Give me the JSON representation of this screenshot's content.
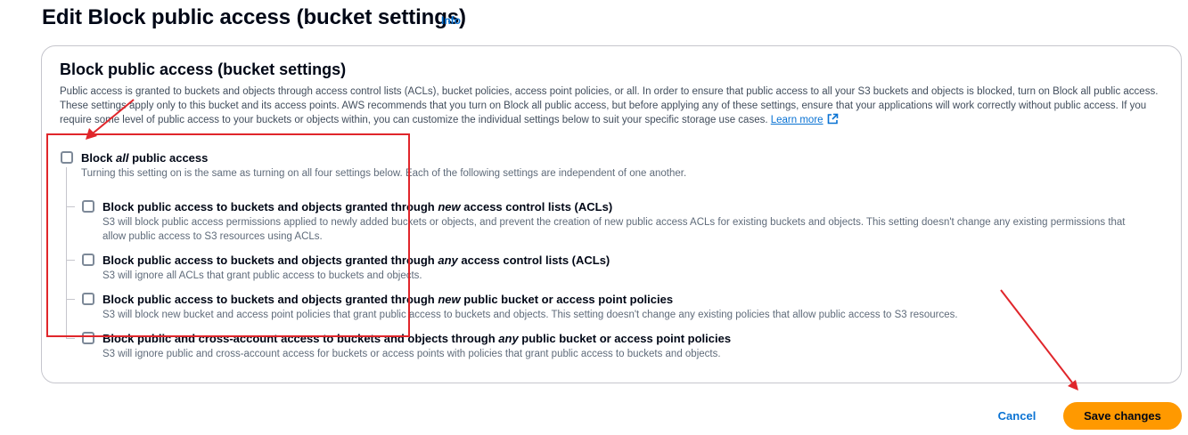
{
  "header": {
    "title": "Edit Block public access (bucket settings)",
    "info_label": "Info"
  },
  "panel": {
    "title": "Block public access (bucket settings)",
    "description": "Public access is granted to buckets and objects through access control lists (ACLs), bucket policies, access point policies, or all. In order to ensure that public access to all your S3 buckets and objects is blocked, turn on Block all public access. These settings apply only to this bucket and its access points. AWS recommends that you turn on Block all public access, but before applying any of these settings, ensure that your applications will work correctly without public access. If you require some level of public access to your buckets or objects within, you can customize the individual settings below to suit your specific storage use cases.",
    "learn_more": "Learn more"
  },
  "block_all": {
    "label_pre": "Block ",
    "label_em": "all",
    "label_post": " public access",
    "description": "Turning this setting on is the same as turning on all four settings below. Each of the following settings are independent of one another.",
    "checked": false
  },
  "settings": [
    {
      "label_pre": "Block public access to buckets and objects granted through ",
      "label_em": "new",
      "label_post": " access control lists (ACLs)",
      "description": "S3 will block public access permissions applied to newly added buckets or objects, and prevent the creation of new public access ACLs for existing buckets and objects. This setting doesn't change any existing permissions that allow public access to S3 resources using ACLs.",
      "checked": false
    },
    {
      "label_pre": "Block public access to buckets and objects granted through ",
      "label_em": "any",
      "label_post": " access control lists (ACLs)",
      "description": "S3 will ignore all ACLs that grant public access to buckets and objects.",
      "checked": false
    },
    {
      "label_pre": "Block public access to buckets and objects granted through ",
      "label_em": "new",
      "label_post": " public bucket or access point policies",
      "description": "S3 will block new bucket and access point policies that grant public access to buckets and objects. This setting doesn't change any existing policies that allow public access to S3 resources.",
      "checked": false
    },
    {
      "label_pre": "Block public and cross-account access to buckets and objects through ",
      "label_em": "any",
      "label_post": " public bucket or access point policies",
      "description": "S3 will ignore public and cross-account access for buckets or access points with policies that grant public access to buckets and objects.",
      "checked": false
    }
  ],
  "footer": {
    "cancel_label": "Cancel",
    "save_label": "Save changes"
  },
  "colors": {
    "primary_button": "#ff9900",
    "link": "#0972d3",
    "annotation": "#e0262b"
  },
  "icons": {
    "external_link": "external-link-icon"
  }
}
